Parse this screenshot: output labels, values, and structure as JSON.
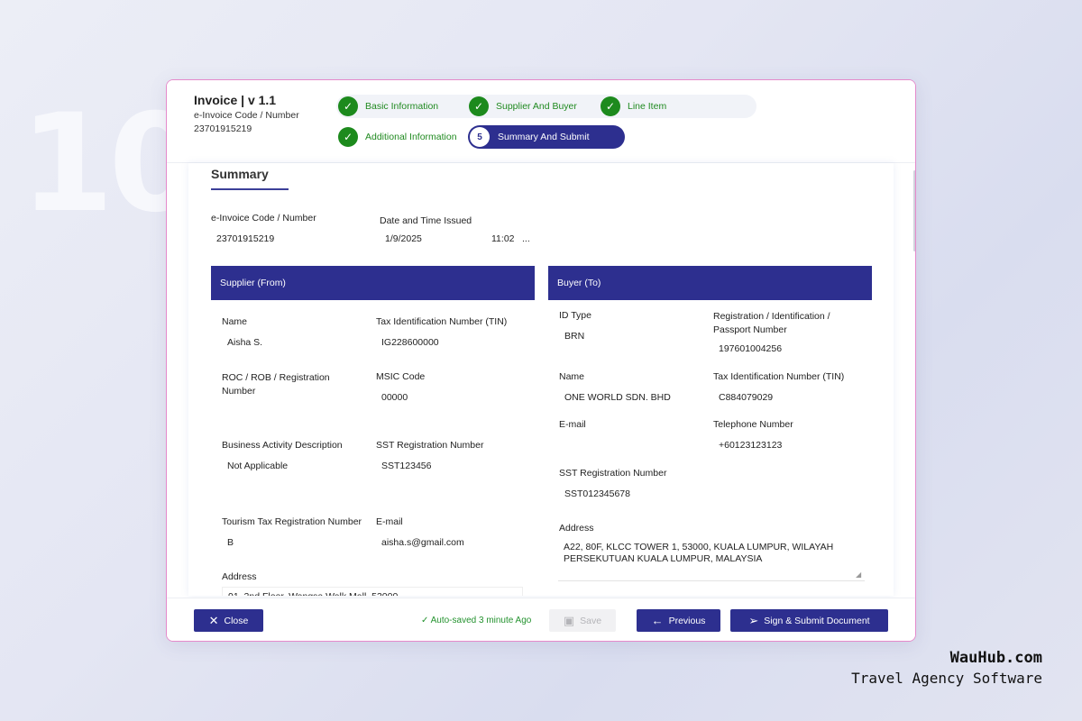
{
  "background_number": "10",
  "brand": {
    "name": "WauHub.com",
    "tagline": "Travel Agency Software"
  },
  "header": {
    "title": "Invoice | v 1.1",
    "code_label": "e-Invoice Code / Number",
    "code_value": "23701915219"
  },
  "steps": [
    {
      "label": "Basic Information",
      "status": "done"
    },
    {
      "label": "Supplier And Buyer",
      "status": "done"
    },
    {
      "label": "Line Item",
      "status": "done"
    },
    {
      "label": "Additional Information",
      "status": "done"
    },
    {
      "label": "Summary And Submit",
      "status": "active",
      "number": "5"
    }
  ],
  "summary": {
    "title": "Summary",
    "code_label": "e-Invoice Code / Number",
    "code_value": "23701915219",
    "date_label": "Date and Time Issued",
    "date_value": "1/9/2025",
    "time_value": "11:02",
    "more": "..."
  },
  "supplier": {
    "heading": "Supplier (From)",
    "name_label": "Name",
    "name_value": "Aisha S.",
    "tin_label": "Tax Identification Number (TIN)",
    "tin_value": "IG228600000",
    "roc_label": "ROC / ROB / Registration Number",
    "roc_value": "",
    "msic_label": "MSIC Code",
    "msic_value": "00000",
    "activity_label": "Business Activity Description",
    "activity_value": "Not Applicable",
    "sst_label": "SST Registration Number",
    "sst_value": "SST123456",
    "tourism_label": "Tourism Tax Registration Number",
    "tourism_value": "B",
    "email_label": "E-mail",
    "email_value": "aisha.s@gmail.com",
    "address_label": "Address",
    "address_value": "91, 2nd Floor, Wangsa Walk Mall, 53000"
  },
  "buyer": {
    "heading": "Buyer (To)",
    "idtype_label": "ID Type",
    "idtype_value": "BRN",
    "reg_label": "Registration / Identification / Passport Number",
    "reg_value": "197601004256",
    "name_label": "Name",
    "name_value": "ONE WORLD SDN. BHD",
    "tin_label": "Tax Identification Number (TIN)",
    "tin_value": "C884079029",
    "email_label": "E-mail",
    "email_value": "",
    "phone_label": "Telephone Number",
    "phone_value": "+60123123123",
    "sst_label": "SST Registration Number",
    "sst_value": "SST012345678",
    "address_label": "Address",
    "address_value": "A22, 80F, KLCC TOWER 1, 53000, KUALA LUMPUR, WILAYAH PERSEKUTUAN KUALA LUMPUR, MALAYSIA"
  },
  "footer": {
    "close_label": "Close",
    "autosave": "Auto-saved 3 minute Ago",
    "save_label": "Save",
    "previous_label": "Previous",
    "submit_label": "Sign & Submit Document"
  },
  "colors": {
    "primary": "#2d2f8f",
    "success": "#1d8a1d",
    "window_border": "#e58acb"
  }
}
